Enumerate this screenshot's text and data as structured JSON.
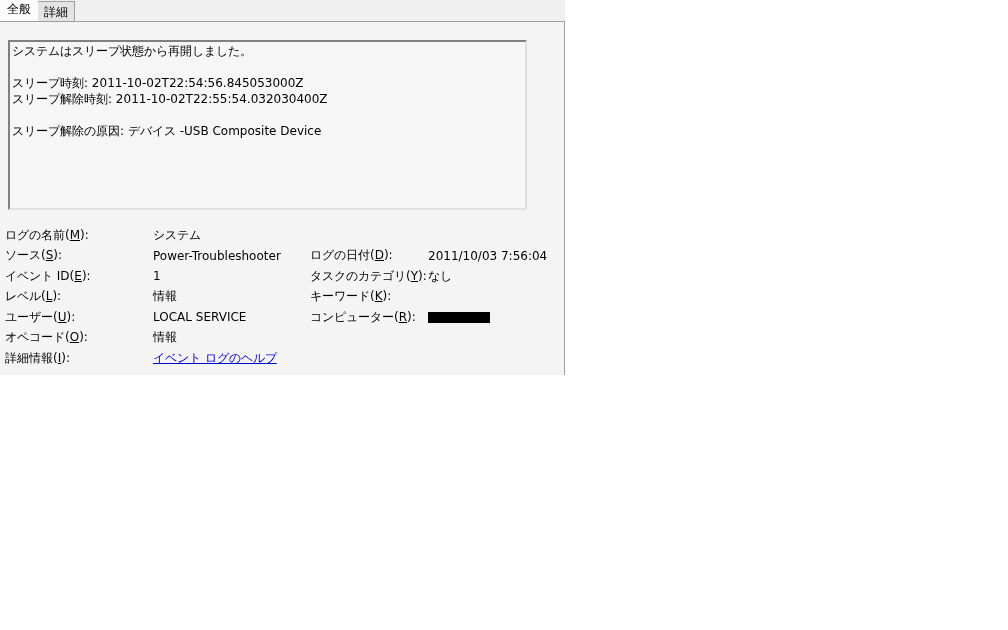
{
  "tabs": [
    {
      "label": "全般",
      "selected": true
    },
    {
      "label": "詳細",
      "selected": false
    }
  ],
  "description": [
    [
      "システムはスリープ状態から再開しました。"
    ],
    [
      "スリープ時刻: 2011-10-02T22:54:56.845053000Z",
      "スリープ解除時刻: 2011-10-02T22:55:54.032030400Z"
    ],
    [
      "スリープ解除の原因: デバイス -USB Composite Device"
    ]
  ],
  "properties": [
    {
      "left": {
        "label_before": "ログの名前(",
        "access_key": "M",
        "label_after": "):",
        "kind": "text",
        "value": "システム"
      }
    },
    {
      "left": {
        "label_before": "ソース(",
        "access_key": "S",
        "label_after": "):",
        "kind": "text",
        "value": "Power-Troubleshooter"
      },
      "right": {
        "label_before": "ログの日付(",
        "access_key": "D",
        "label_after": "):",
        "kind": "text",
        "value": "2011/10/03 7:56:04"
      }
    },
    {
      "left": {
        "label_before": "イベント ID(",
        "access_key": "E",
        "label_after": "):",
        "kind": "text",
        "value": "1"
      },
      "right": {
        "label_before": "タスクのカテゴリ(",
        "access_key": "Y",
        "label_after": "):",
        "kind": "text",
        "value": "なし"
      }
    },
    {
      "left": {
        "label_before": "レベル(",
        "access_key": "L",
        "label_after": "):",
        "kind": "text",
        "value": "情報"
      },
      "right": {
        "label_before": "キーワード(",
        "access_key": "K",
        "label_after": "):",
        "kind": "empty"
      }
    },
    {
      "left": {
        "label_before": "ユーザー(",
        "access_key": "U",
        "label_after": "):",
        "kind": "text",
        "value": "LOCAL SERVICE"
      },
      "right": {
        "label_before": "コンピューター(",
        "access_key": "R",
        "label_after": "):",
        "kind": "redacted"
      }
    },
    {
      "left": {
        "label_before": "オペコード(",
        "access_key": "O",
        "label_after": "):",
        "kind": "text",
        "value": "情報"
      }
    },
    {
      "left": {
        "label_before": "詳細情報(",
        "access_key": "I",
        "label_after": "):",
        "kind": "link",
        "value": "イベント ログのヘルプ"
      }
    }
  ]
}
